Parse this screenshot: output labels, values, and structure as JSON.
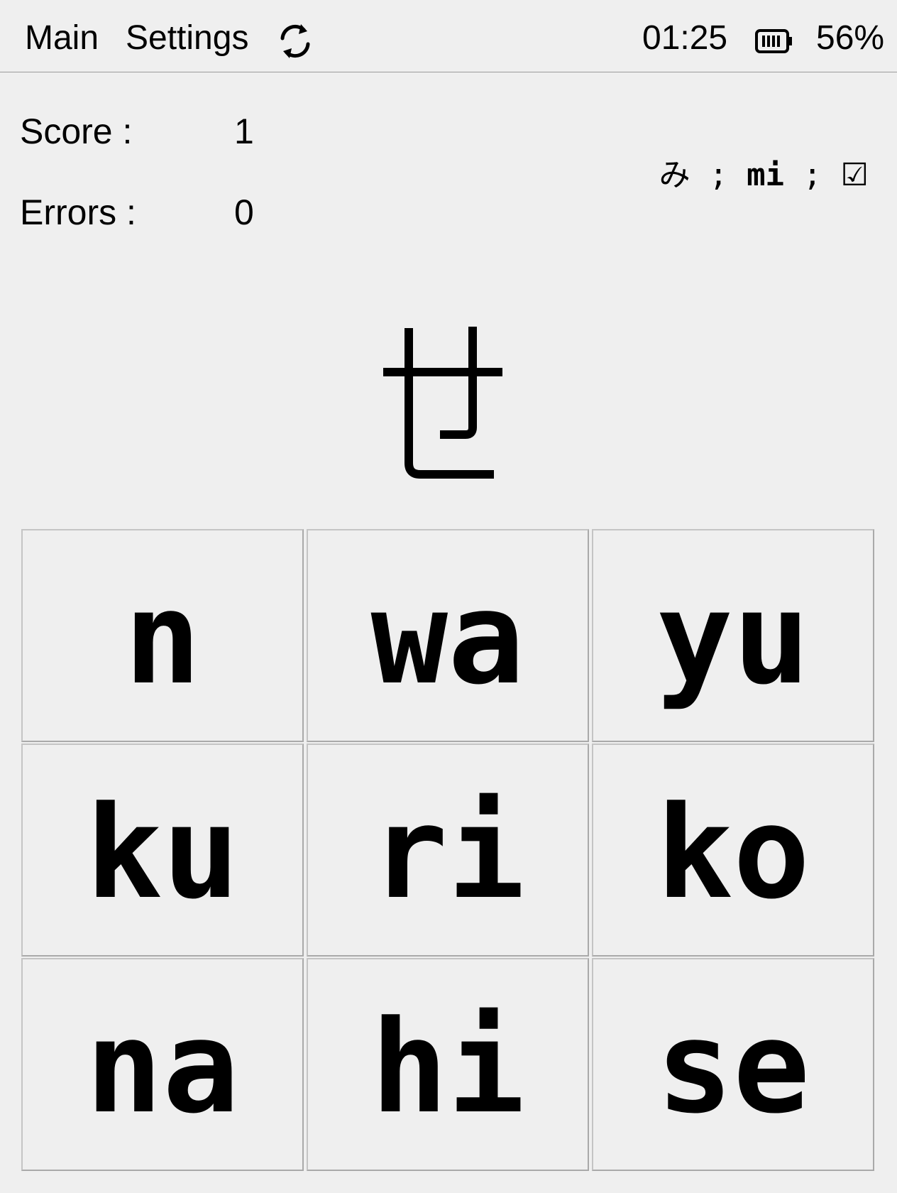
{
  "topbar": {
    "menu_main": "Main",
    "menu_settings": "Settings",
    "refresh_icon": "refresh-icon",
    "time": "01:25",
    "battery_icon": "battery-icon",
    "battery_percent": "56%"
  },
  "stats": {
    "score_label": "Score :",
    "score_value": "1",
    "errors_label": "Errors :",
    "errors_value": "0"
  },
  "last_answer": {
    "kana": "み",
    "separator": ";",
    "romaji": "mi",
    "result_icon": "☑"
  },
  "question": {
    "kana": "せ"
  },
  "answers": [
    [
      "n",
      "wa",
      "yu"
    ],
    [
      "ku",
      "ri",
      "ko"
    ],
    [
      "na",
      "hi",
      "se"
    ]
  ],
  "colors": {
    "background": "#efefef",
    "text": "#000000",
    "cell_border": "#c4c4c4"
  }
}
